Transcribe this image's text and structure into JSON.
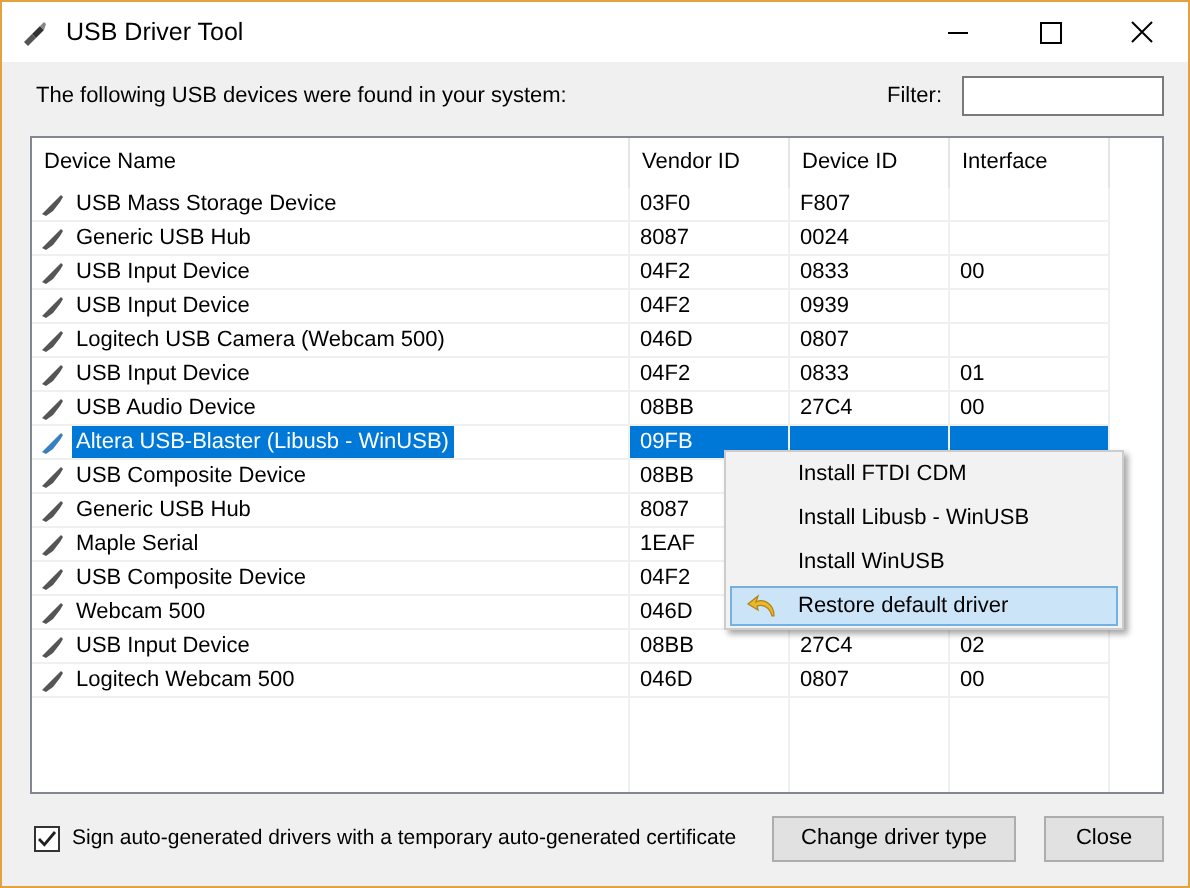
{
  "window": {
    "title": "USB Driver Tool"
  },
  "intro": "The following USB devices were found in your system:",
  "filter": {
    "label": "Filter:"
  },
  "table": {
    "columns": [
      "Device Name",
      "Vendor ID",
      "Device ID",
      "Interface"
    ],
    "rows": [
      {
        "name": "USB Mass Storage Device",
        "vendor_id": "03F0",
        "device_id": "F807",
        "interface": "",
        "selected": false
      },
      {
        "name": "Generic USB Hub",
        "vendor_id": "8087",
        "device_id": "0024",
        "interface": "",
        "selected": false
      },
      {
        "name": "USB Input Device",
        "vendor_id": "04F2",
        "device_id": "0833",
        "interface": "00",
        "selected": false
      },
      {
        "name": "USB Input Device",
        "vendor_id": "04F2",
        "device_id": "0939",
        "interface": "",
        "selected": false
      },
      {
        "name": "Logitech USB Camera (Webcam 500)",
        "vendor_id": "046D",
        "device_id": "0807",
        "interface": "",
        "selected": false
      },
      {
        "name": "USB Input Device",
        "vendor_id": "04F2",
        "device_id": "0833",
        "interface": "01",
        "selected": false
      },
      {
        "name": "USB Audio Device",
        "vendor_id": "08BB",
        "device_id": "27C4",
        "interface": "00",
        "selected": false
      },
      {
        "name": "Altera USB-Blaster (Libusb - WinUSB)",
        "vendor_id": "09FB",
        "device_id": "",
        "interface": "",
        "selected": true
      },
      {
        "name": "USB Composite Device",
        "vendor_id": "08BB",
        "device_id": "",
        "interface": "",
        "selected": false
      },
      {
        "name": "Generic USB Hub",
        "vendor_id": "8087",
        "device_id": "",
        "interface": "",
        "selected": false
      },
      {
        "name": "Maple Serial",
        "vendor_id": "1EAF",
        "device_id": "",
        "interface": "",
        "selected": false
      },
      {
        "name": "USB Composite Device",
        "vendor_id": "04F2",
        "device_id": "",
        "interface": "",
        "selected": false
      },
      {
        "name": "Webcam 500",
        "vendor_id": "046D",
        "device_id": "",
        "interface": "",
        "selected": false
      },
      {
        "name": "USB Input Device",
        "vendor_id": "08BB",
        "device_id": "27C4",
        "interface": "02",
        "selected": false
      },
      {
        "name": "Logitech Webcam 500",
        "vendor_id": "046D",
        "device_id": "0807",
        "interface": "00",
        "selected": false
      }
    ]
  },
  "context_menu": {
    "items": [
      {
        "label": "Install FTDI CDM",
        "kind": "plain",
        "selected": false
      },
      {
        "label": "Install Libusb - WinUSB",
        "kind": "plain",
        "selected": false
      },
      {
        "label": "Install WinUSB",
        "kind": "plain",
        "selected": false
      },
      {
        "label": "Restore default driver",
        "kind": "with_icon",
        "selected": true
      }
    ]
  },
  "sign_option": {
    "label": "Sign auto-generated drivers with a temporary auto-generated certificate",
    "checked": true
  },
  "buttons": [
    "Change driver type",
    "Close"
  ]
}
